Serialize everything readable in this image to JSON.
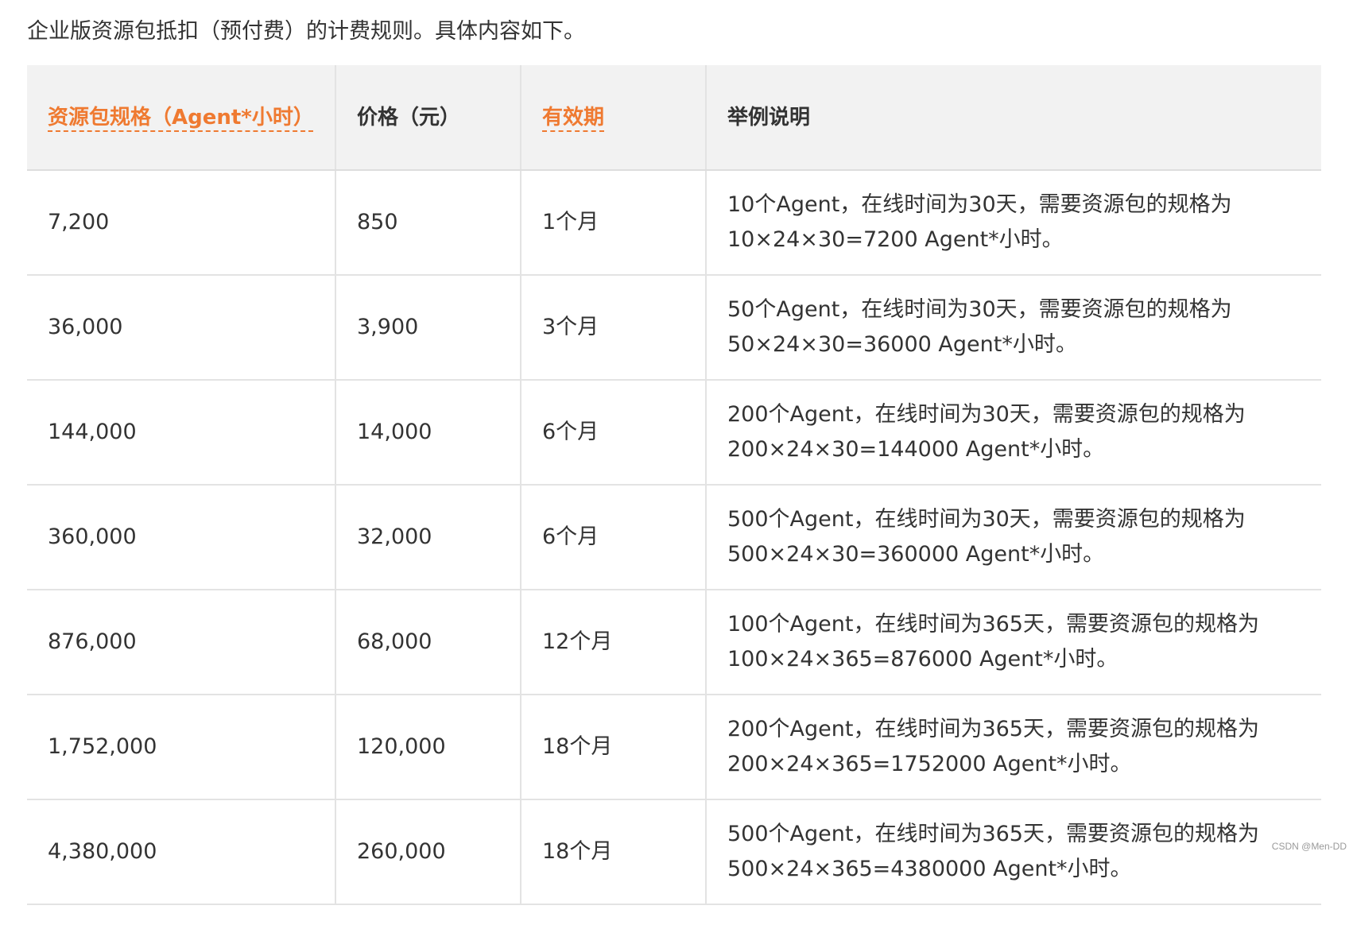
{
  "intro_text": "企业版资源包抵扣（预付费）的计费规则。具体内容如下。",
  "colors": {
    "accent": "#ef7a31",
    "header_bg": "#f2f2f2",
    "border": "#e3e3e3",
    "text": "#333333"
  },
  "table": {
    "headers": {
      "spec": "资源包规格（Agent*小时）",
      "price": "价格（元）",
      "validity": "有效期",
      "example": "举例说明"
    },
    "rows": [
      {
        "spec": "7,200",
        "price": "850",
        "validity": "1个月",
        "example_line1": "10个Agent，在线时间为30天，需要资源包的规格为",
        "example_line2": "10×24×30=7200 Agent*小时。"
      },
      {
        "spec": "36,000",
        "price": "3,900",
        "validity": "3个月",
        "example_line1": "50个Agent，在线时间为30天，需要资源包的规格为",
        "example_line2": "50×24×30=36000 Agent*小时。"
      },
      {
        "spec": "144,000",
        "price": "14,000",
        "validity": "6个月",
        "example_line1": "200个Agent，在线时间为30天，需要资源包的规格为",
        "example_line2": "200×24×30=144000 Agent*小时。"
      },
      {
        "spec": "360,000",
        "price": "32,000",
        "validity": "6个月",
        "example_line1": "500个Agent，在线时间为30天，需要资源包的规格为",
        "example_line2": "500×24×30=360000 Agent*小时。"
      },
      {
        "spec": "876,000",
        "price": "68,000",
        "validity": "12个月",
        "example_line1": "100个Agent，在线时间为365天，需要资源包的规格为",
        "example_line2": "100×24×365=876000 Agent*小时。"
      },
      {
        "spec": "1,752,000",
        "price": "120,000",
        "validity": "18个月",
        "example_line1": "200个Agent，在线时间为365天，需要资源包的规格为",
        "example_line2": "200×24×365=1752000 Agent*小时。"
      },
      {
        "spec": "4,380,000",
        "price": "260,000",
        "validity": "18个月",
        "example_line1": "500个Agent，在线时间为365天，需要资源包的规格为",
        "example_line2": "500×24×365=4380000 Agent*小时。"
      }
    ]
  },
  "watermark": "CSDN @Men-DD"
}
